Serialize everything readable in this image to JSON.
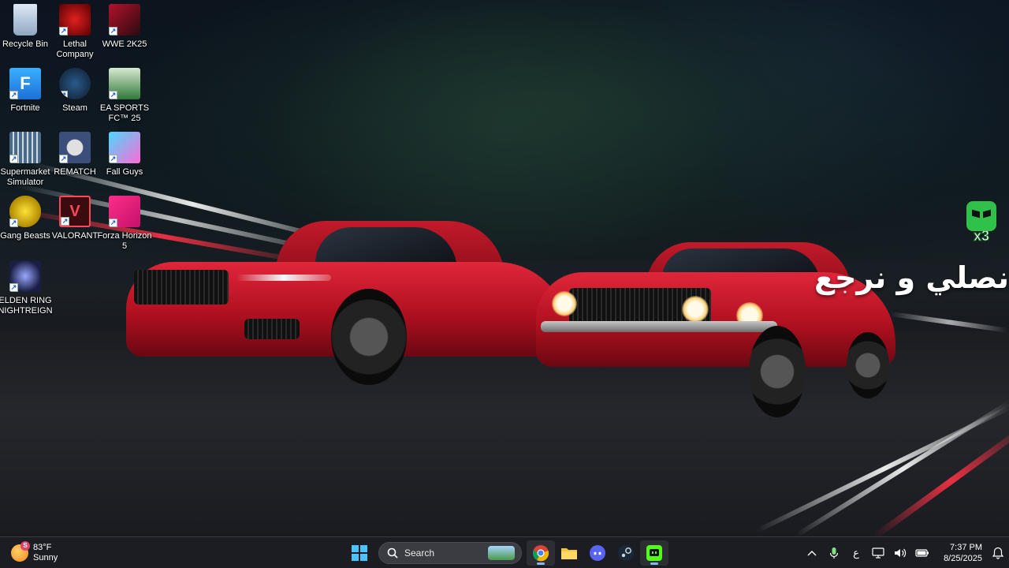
{
  "desktop": {
    "icons": [
      {
        "id": "recycle-bin",
        "label": "Recycle Bin",
        "shortcut": false
      },
      {
        "id": "lethal-company",
        "label": "Lethal Company",
        "shortcut": true
      },
      {
        "id": "wwe-2k25",
        "label": "WWE 2K25",
        "shortcut": true
      },
      {
        "id": "fortnite",
        "label": "Fortnite",
        "shortcut": true
      },
      {
        "id": "steam",
        "label": "Steam",
        "shortcut": true
      },
      {
        "id": "ea-sports-fc-25",
        "label": "EA SPORTS FC™ 25",
        "shortcut": true
      },
      {
        "id": "supermarket-simulator",
        "label": "Supermarket Simulator",
        "shortcut": true
      },
      {
        "id": "rematch",
        "label": "REMATCH",
        "shortcut": true
      },
      {
        "id": "fall-guys",
        "label": "Fall Guys",
        "shortcut": true
      },
      {
        "id": "gang-beasts",
        "label": "Gang Beasts",
        "shortcut": true
      },
      {
        "id": "valorant",
        "label": "VALORANT",
        "shortcut": true
      },
      {
        "id": "forza-horizon-5",
        "label": "Forza Horizon 5",
        "shortcut": true
      },
      {
        "id": "elden-ring-nightreign",
        "label": "ELDEN RING NIGHTREIGN",
        "shortcut": true
      }
    ]
  },
  "overlay": {
    "arabic_text": "نصلي و نرجع",
    "badge_text": "x3"
  },
  "taskbar": {
    "weather": {
      "temp": "83°F",
      "condition": "Sunny",
      "badge": "S"
    },
    "search_label": "Search",
    "apps": [
      "start-icon",
      "chrome-icon",
      "file-explorer-icon",
      "discord-icon",
      "steam-icon",
      "streaming-app-icon"
    ],
    "tray": {
      "language": "ع",
      "time": "7:37 PM",
      "date": "8/25/2025"
    }
  },
  "colors": {
    "accent": "#8ab4f8",
    "taskbar_bg": "#1c1e24",
    "car_red": "#c8172a"
  }
}
